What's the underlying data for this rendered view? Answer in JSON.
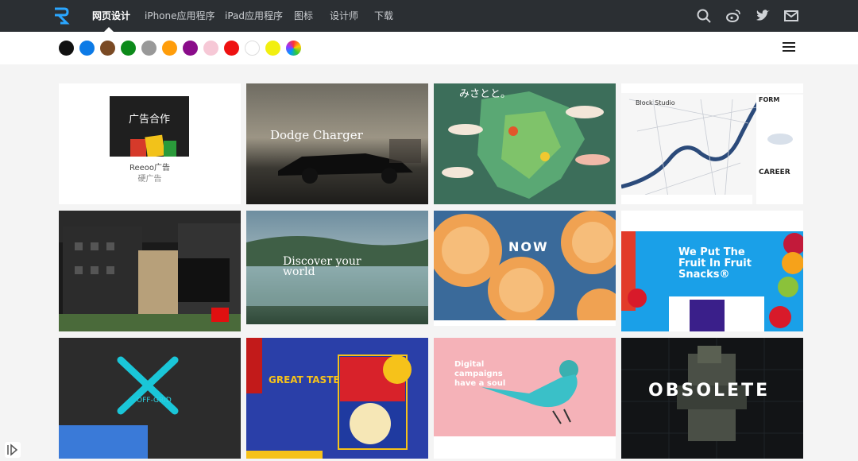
{
  "nav": {
    "logo_icon": "reeoo-logo-icon",
    "items": [
      {
        "label": "网页设计",
        "active": true
      },
      {
        "label": "iPhone应用程序",
        "active": false
      },
      {
        "label": "iPad应用程序",
        "active": false
      },
      {
        "label": "图标",
        "active": false
      },
      {
        "label": "设计师",
        "active": false
      },
      {
        "label": "下载",
        "active": false
      }
    ],
    "right_icons": [
      "search-icon",
      "weibo-icon",
      "twitter-icon",
      "mail-icon"
    ]
  },
  "color_filters": [
    {
      "name": "black",
      "color": "#111111"
    },
    {
      "name": "blue",
      "color": "#0c7ae6"
    },
    {
      "name": "brown",
      "color": "#7a4a24"
    },
    {
      "name": "green",
      "color": "#0c8a1a"
    },
    {
      "name": "gray",
      "color": "#999999"
    },
    {
      "name": "orange",
      "color": "#ff9d0a"
    },
    {
      "name": "purple",
      "color": "#8a0c8a"
    },
    {
      "name": "pink",
      "color": "#f6c8d6"
    },
    {
      "name": "red",
      "color": "#ee1111"
    },
    {
      "name": "white",
      "color": "#ffffff"
    },
    {
      "name": "yellow",
      "color": "#f2ef10"
    },
    {
      "name": "multicolor",
      "color": "rainbow"
    }
  ],
  "ad": {
    "box_text": "广告合作",
    "name": "Reeoo广告",
    "sub": "硬广告"
  },
  "shots": [
    {
      "title": "Dodge Charger"
    },
    {
      "title": "みさとと。"
    },
    {
      "title": "Block Studio"
    },
    {
      "title": "Discover your world"
    },
    {
      "title": "NOW"
    },
    {
      "title": "We Put The Fruit In Fruit Snacks®"
    },
    {
      "title": "OFF-GRID"
    },
    {
      "title": "GREAT TASTE"
    },
    {
      "title": "Digital campaigns have a soul"
    },
    {
      "title": "OBSOLETE"
    },
    {
      "title": "FORM"
    },
    {
      "title": "CAREER"
    }
  ]
}
